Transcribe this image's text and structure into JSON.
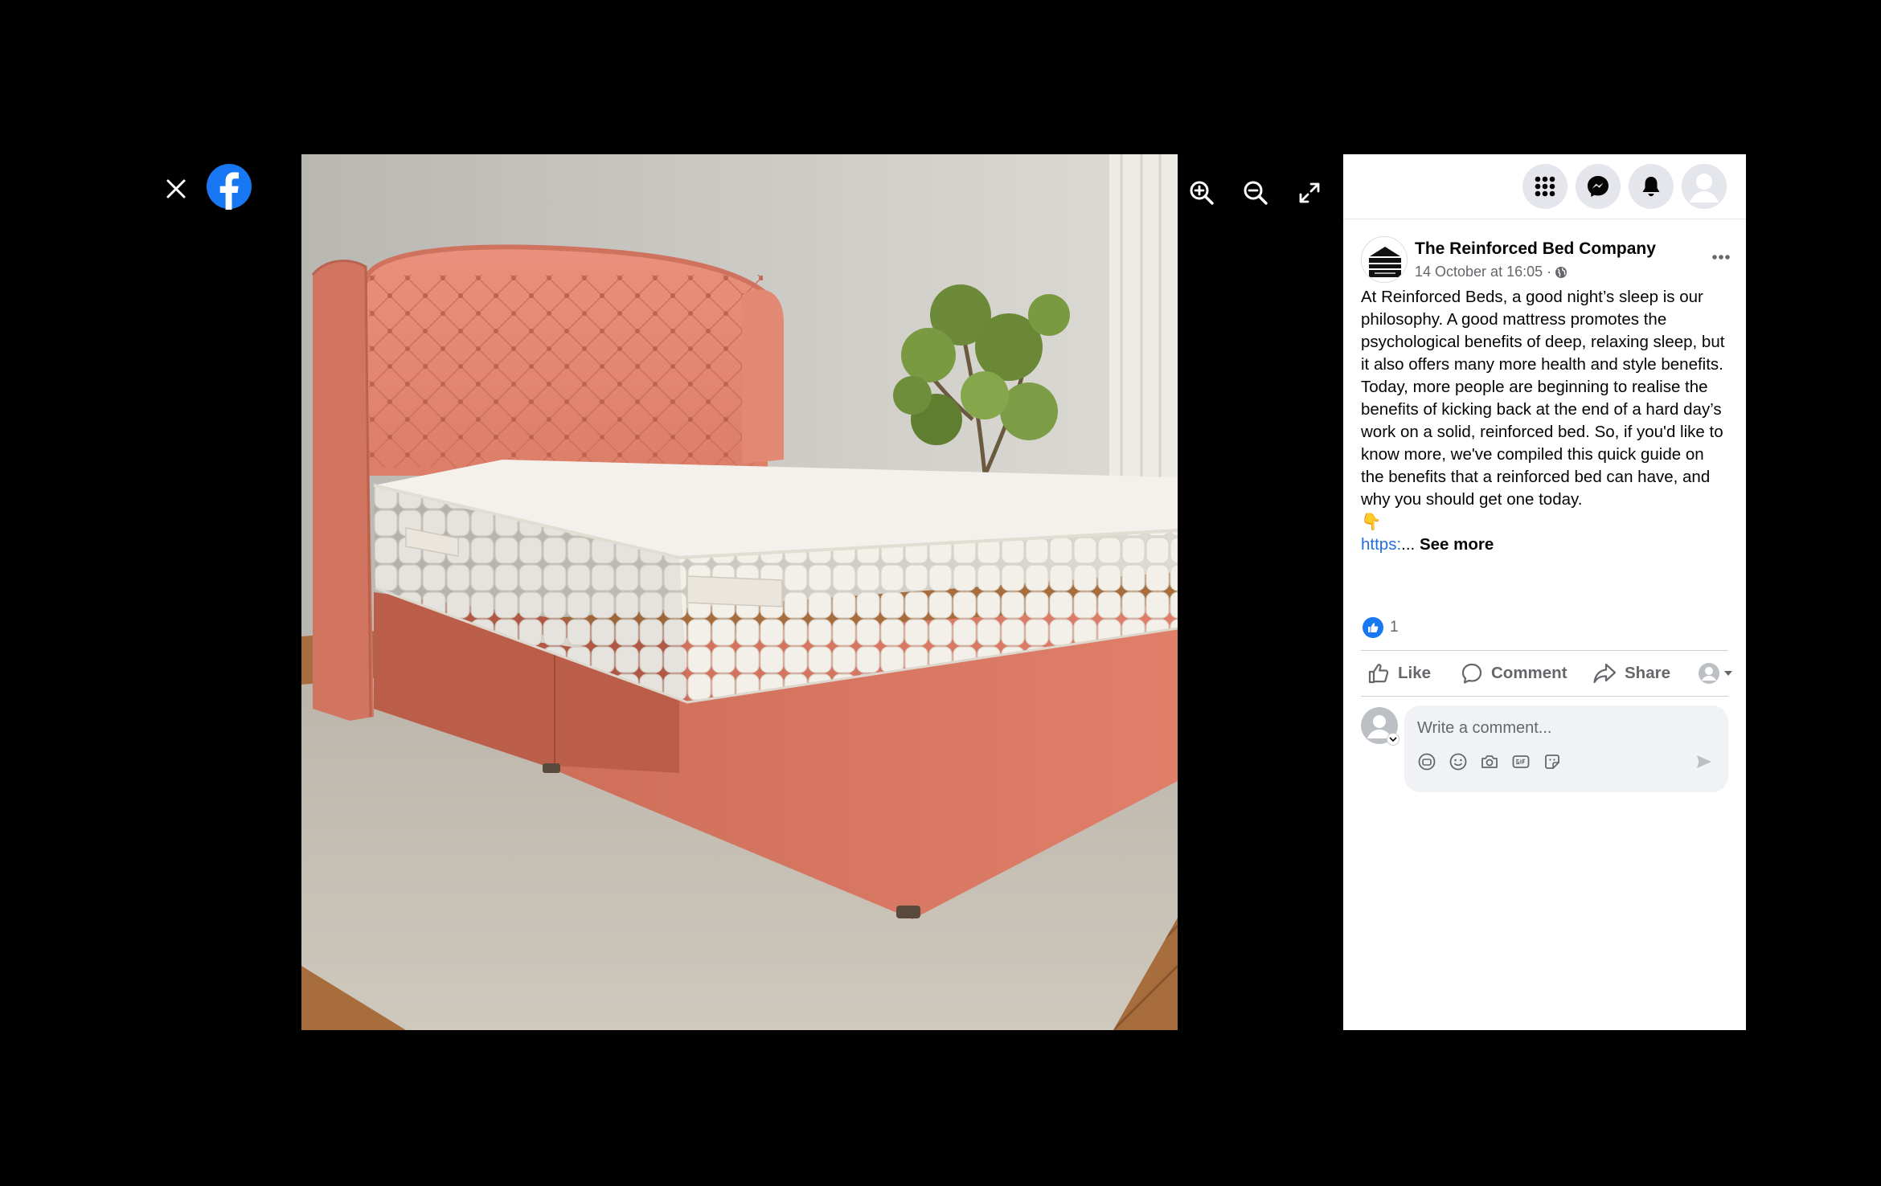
{
  "viewer": {
    "close_label": "Close",
    "photo_alt": "Coral upholstered divan bed with tufted wingback headboard and white mattress"
  },
  "post": {
    "page_name": "The Reinforced Bed Company",
    "timestamp": "14 October at 16:05 ·",
    "body": "At Reinforced Beds, a good night’s sleep is our philosophy. A good mattress promotes the psychological benefits of deep, relaxing sleep, but it also offers many more health and style benefits. Today, more people are beginning to realise the benefits of kicking back at the end of a hard day’s work on a solid, reinforced bed. So, if you'd like to know more, we've compiled this quick guide on the benefits that a reinforced bed can have, and why you should get one today.",
    "emoji": "👇",
    "link_text": "https:",
    "ellipsis": "... ",
    "see_more": "See more",
    "reaction_count": "1"
  },
  "actions": {
    "like": "Like",
    "comment": "Comment",
    "share": "Share"
  },
  "comment_composer": {
    "placeholder": "Write a comment..."
  },
  "colors": {
    "facebook_blue": "#1877f2",
    "link": "#216fdb",
    "secondary_text": "#65676b",
    "button_bg": "#e4e6eb"
  }
}
